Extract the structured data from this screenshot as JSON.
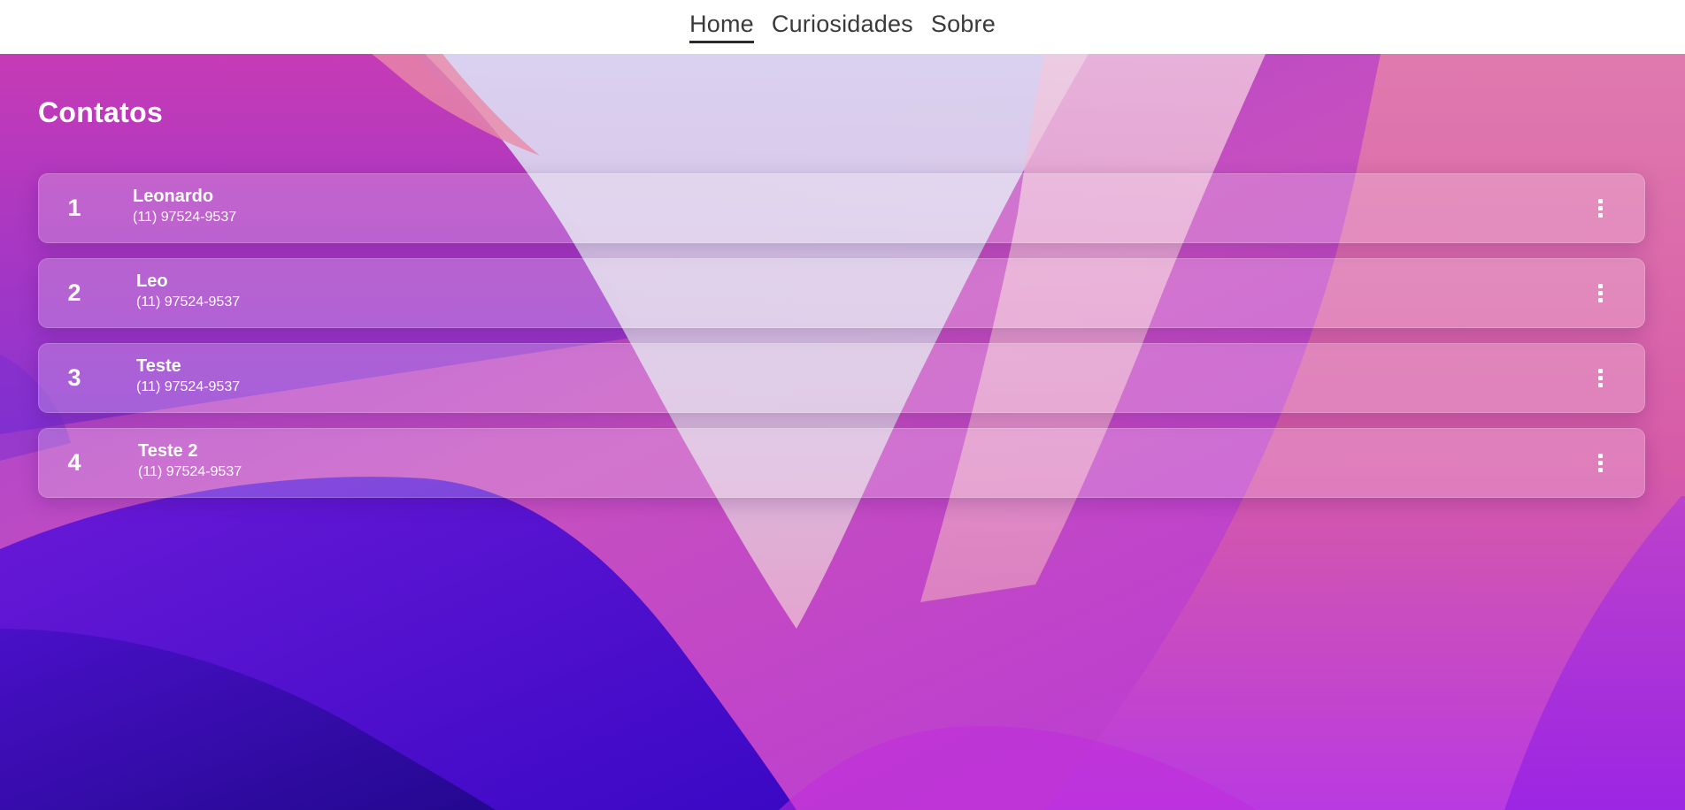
{
  "nav": {
    "items": [
      {
        "label": "Home",
        "active": true
      },
      {
        "label": "Curiosidades",
        "active": false
      },
      {
        "label": "Sobre",
        "active": false
      }
    ]
  },
  "page": {
    "title": "Contatos"
  },
  "contacts": [
    {
      "index": "1",
      "name": "Leonardo",
      "phone": "(11) 97524-9537"
    },
    {
      "index": "2",
      "name": "Leo",
      "phone": "(11) 97524-9537"
    },
    {
      "index": "3",
      "name": "Teste",
      "phone": "(11) 97524-9537"
    },
    {
      "index": "4",
      "name": "Teste 2",
      "phone": "(11) 97524-9537"
    }
  ],
  "icons": {
    "contact_menu": "kebab-menu-icon"
  },
  "colors": {
    "nav_background": "#ffffff",
    "nav_text": "#3a3a3a",
    "text_on_wallpaper": "#ffffff",
    "wallpaper_pink": "#d667b0",
    "wallpaper_magenta": "#c23dc7",
    "wallpaper_purple": "#8a2ad6",
    "wallpaper_indigo": "#3a0ec7",
    "wallpaper_lavender": "#d4d0ee"
  }
}
